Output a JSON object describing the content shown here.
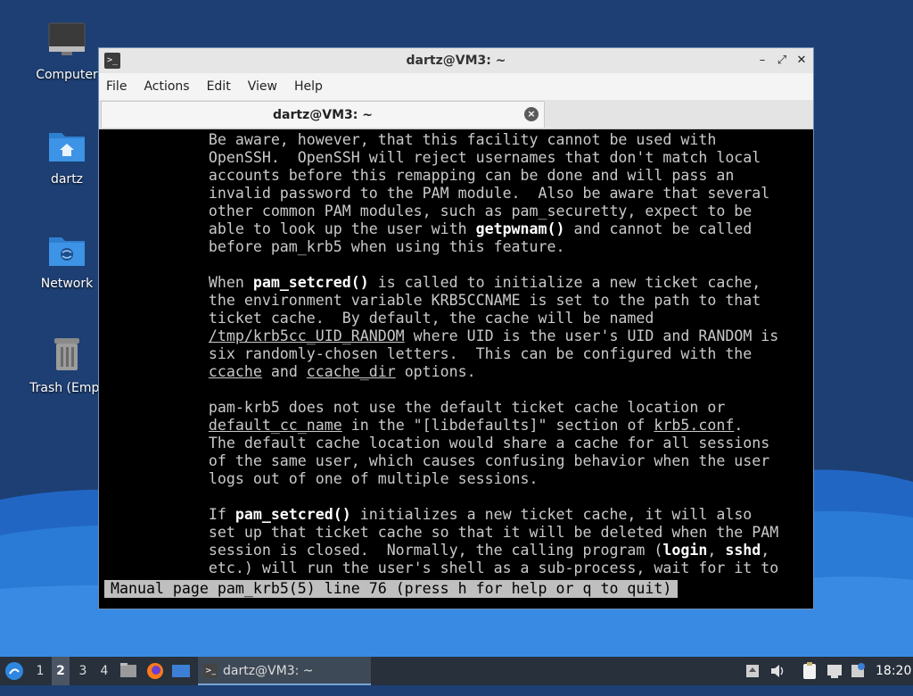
{
  "desktop": {
    "icons": [
      {
        "label": "Computer",
        "icon": "computer-icon"
      },
      {
        "label": "dartz",
        "icon": "home-folder-icon"
      },
      {
        "label": "Network",
        "icon": "network-folder-icon"
      },
      {
        "label": "Trash (Empt",
        "icon": "trash-icon"
      }
    ]
  },
  "window": {
    "title": "dartz@VM3: ~",
    "controls": [
      "–",
      "⤢",
      "✕"
    ],
    "menu": [
      "File",
      "Actions",
      "Edit",
      "View",
      "Help"
    ],
    "tab_label": "dartz@VM3: ~"
  },
  "terminal": {
    "status": "Manual page pam_krb5(5) line 76 (press h for help or q to quit)"
  },
  "taskbar": {
    "workspaces": [
      "1",
      "2",
      "3",
      "4"
    ],
    "active_workspace": "2",
    "window_button": "dartz@VM3: ~",
    "clock": "18:20"
  },
  "colors": {
    "desktop_dark": "#1d3f73",
    "desktop_wave": "#2a7bd6",
    "taskbar": "#27303b",
    "status_bg": "#bfbfbf"
  }
}
